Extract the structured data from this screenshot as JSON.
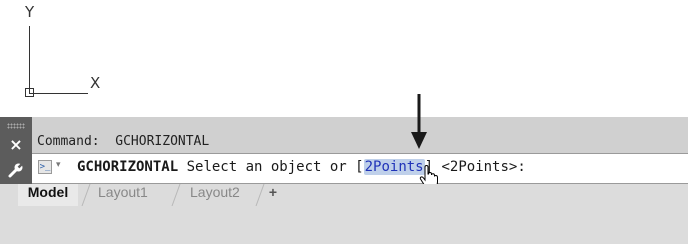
{
  "viewport": {
    "ucs_y_label": "Y",
    "ucs_x_label": "X"
  },
  "command_window": {
    "history_prefix": "Command:",
    "history_command": "GCHORIZONTAL",
    "close_icon": "close-icon",
    "settings_icon": "wrench-icon",
    "prompt": {
      "command_name": "GCHORIZONTAL",
      "text_before": "Select an object or [",
      "option": "2Points",
      "text_after": "] <2Points>:"
    }
  },
  "layout_tabs": {
    "tabs": [
      "Model",
      "Layout1",
      "Layout2"
    ],
    "add_label": "+",
    "active": "Model"
  },
  "colors": {
    "option_highlight": "#bfd0ea",
    "option_text": "#2033b8",
    "panel_dark": "#5c5c5c"
  }
}
